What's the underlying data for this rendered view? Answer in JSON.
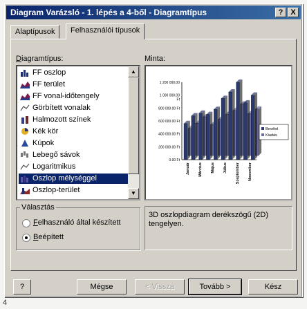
{
  "window": {
    "title": "Diagram Varázsló - 1. lépés a 4-ből - Diagramtípus",
    "help_label": "?",
    "close_label": "X"
  },
  "tabs": [
    {
      "label": "Alaptípusok",
      "active": false
    },
    {
      "label": "Felhasználói típusok",
      "active": true
    }
  ],
  "list": {
    "label": "Diagramtípus:",
    "items": [
      {
        "label": "FF oszlop",
        "icon": "column-chart-icon"
      },
      {
        "label": "FF terület",
        "icon": "area-chart-icon"
      },
      {
        "label": "FF vonal-időtengely",
        "icon": "area-chart-icon"
      },
      {
        "label": "Görbített vonalak",
        "icon": "line-chart-icon"
      },
      {
        "label": "Halmozott színek",
        "icon": "stacked-column-icon"
      },
      {
        "label": "Kék kör",
        "icon": "pie-chart-icon"
      },
      {
        "label": "Kúpok",
        "icon": "cone-chart-icon"
      },
      {
        "label": "Lebegő sávok",
        "icon": "floating-bars-icon"
      },
      {
        "label": "Logaritmikus",
        "icon": "line-chart-icon"
      },
      {
        "label": "Oszlop mélységgel",
        "icon": "column-depth-icon",
        "selected": true
      },
      {
        "label": "Oszlop-terület",
        "icon": "column-area-icon"
      }
    ]
  },
  "preview": {
    "label": "Minta:",
    "description": "3D oszlopdiagram derékszögű (2D) tengelyen."
  },
  "chart_data": {
    "type": "bar",
    "categories": [
      "Január",
      "Március",
      "Május",
      "Július",
      "Szeptember",
      "November"
    ],
    "series": [
      {
        "name": "Bevétel",
        "values": [
          560000,
          680000,
          720000,
          700000,
          780000,
          950000,
          1050000,
          1200000,
          880000,
          1000000
        ]
      },
      {
        "name": "Kiadás",
        "values": [
          420000,
          500000,
          600000,
          480000,
          560000,
          640000,
          700000,
          800000,
          650000,
          720000
        ]
      }
    ],
    "y_ticks": [
      "1 200 000.00",
      "1 000 000.00\nFt",
      "800 000.00 Ft",
      "600 000.00 Ft",
      "400 000.00 Ft",
      "200 000.00 Ft",
      "0.00 Ft"
    ],
    "ylim": [
      0,
      1200000
    ],
    "legend_position": "right",
    "colors": {
      "Bevétel": "#2b3a6e",
      "Kiadás": "#6a6fa8"
    }
  },
  "options": {
    "label": "Választás",
    "radios": [
      {
        "label": "Felhasználó által készített",
        "checked": false
      },
      {
        "label": "Beépített",
        "checked": true
      }
    ]
  },
  "buttons": {
    "help": "?",
    "cancel": "Mégse",
    "back": "< Vissza",
    "next": "Tovább >",
    "finish": "Kész"
  },
  "footer": "4"
}
